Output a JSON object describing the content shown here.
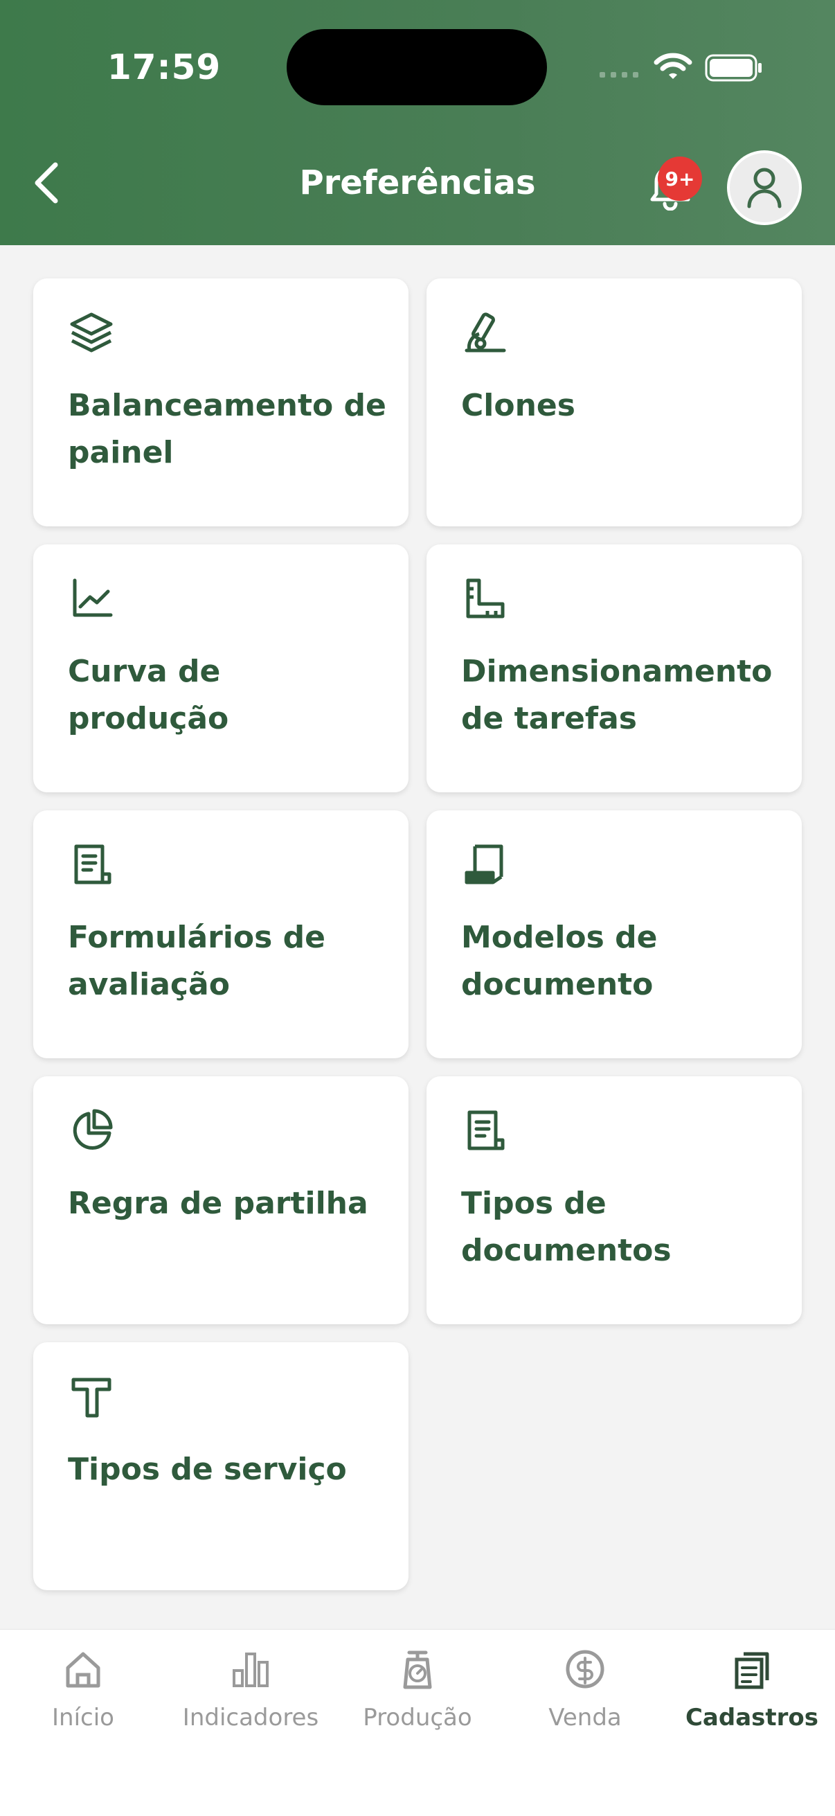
{
  "status_bar": {
    "time": "17:59"
  },
  "header": {
    "title": "Preferências",
    "notification_badge": "9+"
  },
  "cards": [
    {
      "label": "Balanceamento de painel",
      "icon": "layers-icon"
    },
    {
      "label": "Clones",
      "icon": "microscope-icon"
    },
    {
      "label": "Curva de produção",
      "icon": "chart-line-icon"
    },
    {
      "label": "Dimensionamento de tarefas",
      "icon": "ruler-icon"
    },
    {
      "label": "Formulários de avaliação",
      "icon": "form-icon"
    },
    {
      "label": "Modelos de documento",
      "icon": "scroll-icon"
    },
    {
      "label": "Regra de partilha",
      "icon": "pie-chart-icon"
    },
    {
      "label": "Tipos de documentos",
      "icon": "document-icon"
    },
    {
      "label": "Tipos de serviço",
      "icon": "hammer-icon"
    }
  ],
  "nav": [
    {
      "label": "Início",
      "icon": "home-icon",
      "active": false
    },
    {
      "label": "Indicadores",
      "icon": "bar-chart-icon",
      "active": false
    },
    {
      "label": "Produção",
      "icon": "scale-icon",
      "active": false
    },
    {
      "label": "Venda",
      "icon": "dollar-icon",
      "active": false
    },
    {
      "label": "Cadastros",
      "icon": "documents-icon",
      "active": true
    }
  ],
  "colors": {
    "header_green": "#3e7a4b",
    "card_text": "#2f5a3c",
    "badge_red": "#e53935",
    "nav_active": "#2f4a37",
    "nav_inactive": "#9a9a9a"
  }
}
